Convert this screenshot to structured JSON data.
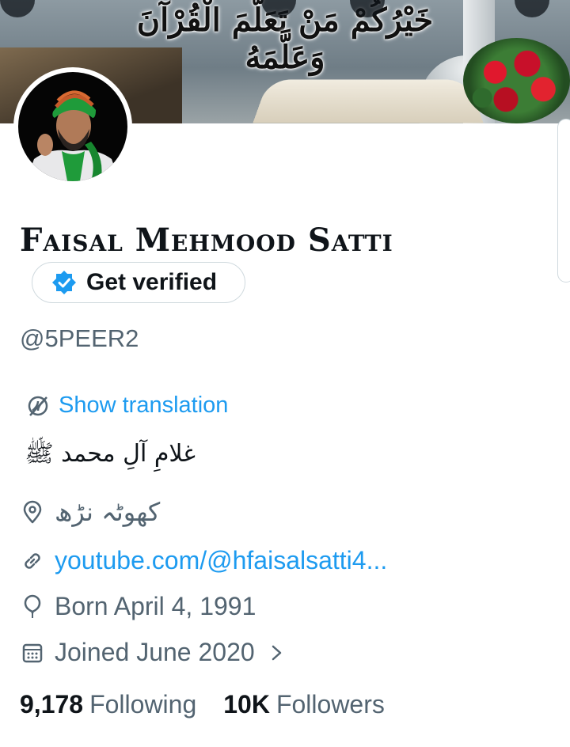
{
  "banner": {
    "arabic_text": "خَيْرُكُمْ مَنْ تَعَلَّمَ الْقُرْآنَ وَعَلَّمَهُ"
  },
  "profile": {
    "display_name": "Faisal Mehmood Satti",
    "verify_label": "Get verified",
    "handle": "@5PEER2",
    "translate_label": "Show translation",
    "bio": "غلامِ آلِ محمد ﷺ",
    "location": "کھوٹہ نڑھ",
    "website": "youtube.com/@hfaisalsatti4...",
    "birth": "Born April 4, 1991",
    "joined": "Joined June 2020"
  },
  "stats": {
    "following_count": "9,178",
    "following_label": "Following",
    "followers_count": "10K",
    "followers_label": "Followers"
  },
  "colors": {
    "accent": "#1d9bf0",
    "secondary_text": "#536471",
    "primary_text": "#0f1419",
    "border": "#cfd9de"
  },
  "icons": {
    "verify": "verified-badge-icon",
    "translate": "translate-icon",
    "location": "location-pin-icon",
    "link": "link-icon",
    "birth": "balloon-icon",
    "joined": "calendar-icon",
    "more": "chevron-right-icon"
  }
}
